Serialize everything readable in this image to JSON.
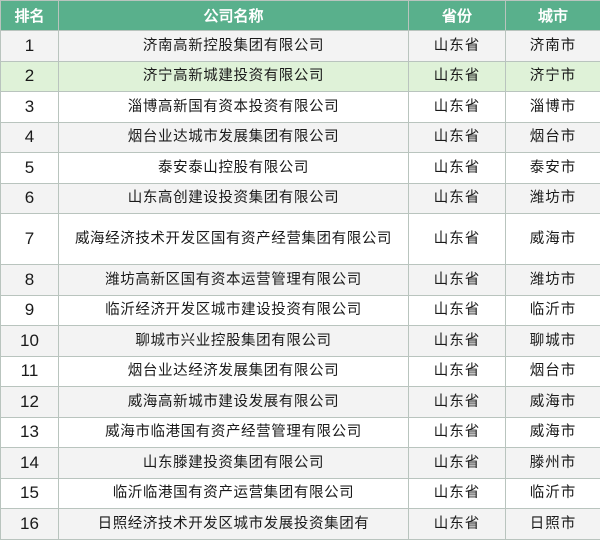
{
  "header": {
    "rank": "排名",
    "company": "公司名称",
    "province": "省份",
    "city": "城市"
  },
  "rows": [
    {
      "rank": "1",
      "company": "济南高新控股集团有限公司",
      "province": "山东省",
      "city": "济南市"
    },
    {
      "rank": "2",
      "company": "济宁高新城建投资有限公司",
      "province": "山东省",
      "city": "济宁市"
    },
    {
      "rank": "3",
      "company": "淄博高新国有资本投资有限公司",
      "province": "山东省",
      "city": "淄博市"
    },
    {
      "rank": "4",
      "company": "烟台业达城市发展集团有限公司",
      "province": "山东省",
      "city": "烟台市"
    },
    {
      "rank": "5",
      "company": "泰安泰山控股有限公司",
      "province": "山东省",
      "city": "泰安市"
    },
    {
      "rank": "6",
      "company": "山东高创建设投资集团有限公司",
      "province": "山东省",
      "city": "潍坊市"
    },
    {
      "rank": "7",
      "company": "威海经济技术开发区国有资产经营集团有限公司",
      "province": "山东省",
      "city": "威海市"
    },
    {
      "rank": "8",
      "company": "潍坊高新区国有资本运营管理有限公司",
      "province": "山东省",
      "city": "潍坊市"
    },
    {
      "rank": "9",
      "company": "临沂经济开发区城市建设投资有限公司",
      "province": "山东省",
      "city": "临沂市"
    },
    {
      "rank": "10",
      "company": "聊城市兴业控股集团有限公司",
      "province": "山东省",
      "city": "聊城市"
    },
    {
      "rank": "11",
      "company": "烟台业达经济发展集团有限公司",
      "province": "山东省",
      "city": "烟台市"
    },
    {
      "rank": "12",
      "company": "威海高新城市建设发展有限公司",
      "province": "山东省",
      "city": "威海市"
    },
    {
      "rank": "13",
      "company": "威海市临港国有资产经营管理有限公司",
      "province": "山东省",
      "city": "威海市"
    },
    {
      "rank": "14",
      "company": "山东滕建投资集团有限公司",
      "province": "山东省",
      "city": "滕州市"
    },
    {
      "rank": "15",
      "company": "临沂临港国有资产运营集团有限公司",
      "province": "山东省",
      "city": "临沂市"
    },
    {
      "rank": "16",
      "company": "日照经济技术开发区城市发展投资集团有",
      "province": "山东省",
      "city": "日照市"
    }
  ]
}
